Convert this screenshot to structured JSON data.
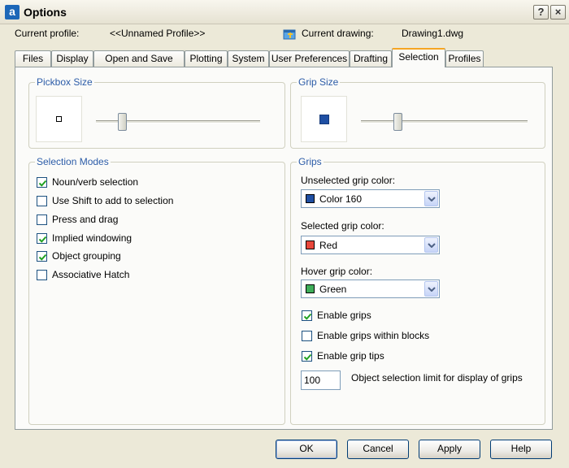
{
  "window": {
    "title": "Options",
    "app_icon_letter": "a",
    "help_glyph": "?",
    "close_glyph": "×"
  },
  "profile": {
    "current_profile_label": "Current profile:",
    "current_profile_value": "<<Unnamed Profile>>",
    "current_drawing_label": "Current drawing:",
    "current_drawing_value": "Drawing1.dwg"
  },
  "tabs": [
    {
      "label": "Files"
    },
    {
      "label": "Display"
    },
    {
      "label": "Open and Save"
    },
    {
      "label": "Plotting"
    },
    {
      "label": "System"
    },
    {
      "label": "User Preferences"
    },
    {
      "label": "Drafting"
    },
    {
      "label": "Selection",
      "active": true
    },
    {
      "label": "Profiles"
    }
  ],
  "pickbox": {
    "label": "Pickbox Size",
    "slider_fraction": 0.17
  },
  "grip_size": {
    "label": "Grip Size",
    "slider_fraction": 0.23
  },
  "selection_modes": {
    "label": "Selection Modes",
    "options": [
      {
        "label": "Noun/verb selection",
        "checked": true
      },
      {
        "label": "Use Shift to add to selection",
        "checked": false
      },
      {
        "label": "Press and drag",
        "checked": false
      },
      {
        "label": "Implied windowing",
        "checked": true
      },
      {
        "label": "Object grouping",
        "checked": true
      },
      {
        "label": "Associative Hatch",
        "checked": false
      }
    ]
  },
  "grips": {
    "label": "Grips",
    "unselected": {
      "label": "Unselected grip color:",
      "value": "Color 160",
      "swatch": "#1f4fa3"
    },
    "selected": {
      "label": "Selected grip color:",
      "value": "Red",
      "swatch": "#e8473b"
    },
    "hover": {
      "label": "Hover grip color:",
      "value": "Green",
      "swatch": "#3fae5a"
    },
    "options": [
      {
        "label": "Enable grips",
        "checked": true
      },
      {
        "label": "Enable grips within blocks",
        "checked": false
      },
      {
        "label": "Enable grip tips",
        "checked": true
      }
    ],
    "limit_value": "100",
    "limit_label": "Object selection limit for display of grips"
  },
  "buttons": {
    "ok": "OK",
    "cancel": "Cancel",
    "apply": "Apply",
    "help": "Help"
  },
  "colors": {
    "group_label": "#2c5ca8",
    "active_tab_accent": "#f5a623",
    "grip_preview": "#1f4fa3"
  }
}
